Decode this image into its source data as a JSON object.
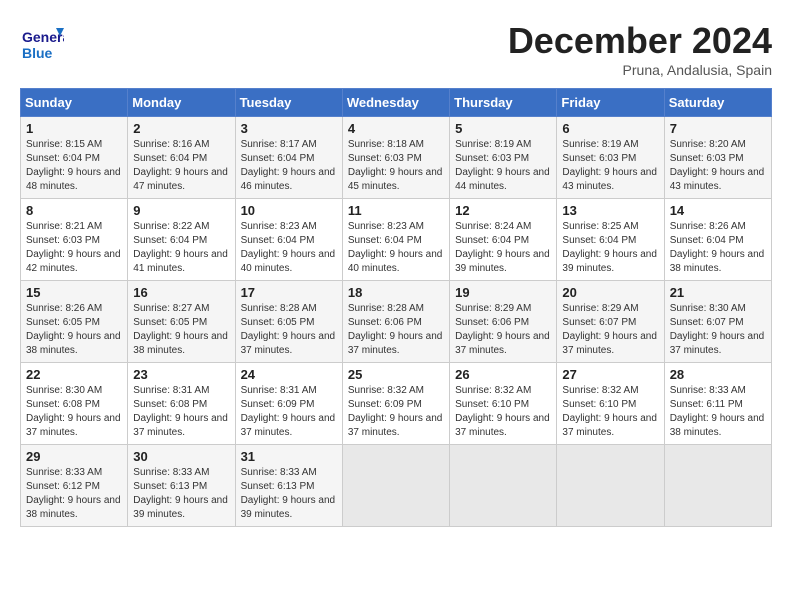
{
  "header": {
    "logo_general": "General",
    "logo_blue": "Blue",
    "month_title": "December 2024",
    "location": "Pruna, Andalusia, Spain"
  },
  "calendar": {
    "days_of_week": [
      "Sunday",
      "Monday",
      "Tuesday",
      "Wednesday",
      "Thursday",
      "Friday",
      "Saturday"
    ],
    "weeks": [
      [
        {
          "day": "",
          "empty": true
        },
        {
          "day": "",
          "empty": true
        },
        {
          "day": "",
          "empty": true
        },
        {
          "day": "",
          "empty": true
        },
        {
          "day": "",
          "empty": true
        },
        {
          "day": "",
          "empty": true
        },
        {
          "day": "1",
          "sunrise": "8:20 AM",
          "sunset": "6:03 PM",
          "daylight": "9 hours and 43 minutes."
        }
      ],
      [
        {
          "day": "2",
          "sunrise": "8:16 AM",
          "sunset": "6:04 PM",
          "daylight": "9 hours and 47 minutes."
        },
        {
          "day": "3",
          "sunrise": "8:17 AM",
          "sunset": "6:04 PM",
          "daylight": "9 hours and 46 minutes."
        },
        {
          "day": "4",
          "sunrise": "8:18 AM",
          "sunset": "6:03 PM",
          "daylight": "9 hours and 45 minutes."
        },
        {
          "day": "5",
          "sunrise": "8:19 AM",
          "sunset": "6:03 PM",
          "daylight": "9 hours and 44 minutes."
        },
        {
          "day": "6",
          "sunrise": "8:19 AM",
          "sunset": "6:03 PM",
          "daylight": "9 hours and 43 minutes."
        },
        {
          "day": "7",
          "sunrise": "8:20 AM",
          "sunset": "6:03 PM",
          "daylight": "9 hours and 43 minutes."
        },
        {
          "day": "8",
          "sunrise": "8:21 AM",
          "sunset": "6:03 PM",
          "daylight": "9 hours and 42 minutes."
        }
      ],
      [
        {
          "day": "1",
          "sunrise": "8:15 AM",
          "sunset": "6:04 PM",
          "daylight": "9 hours and 48 minutes."
        },
        {
          "day": "9",
          "sunrise": "8:22 AM",
          "sunset": "6:04 PM",
          "daylight": "9 hours and 41 minutes."
        },
        {
          "day": "10",
          "sunrise": "8:23 AM",
          "sunset": "6:04 PM",
          "daylight": "9 hours and 40 minutes."
        },
        {
          "day": "11",
          "sunrise": "8:23 AM",
          "sunset": "6:04 PM",
          "daylight": "9 hours and 40 minutes."
        },
        {
          "day": "12",
          "sunrise": "8:24 AM",
          "sunset": "6:04 PM",
          "daylight": "9 hours and 39 minutes."
        },
        {
          "day": "13",
          "sunrise": "8:25 AM",
          "sunset": "6:04 PM",
          "daylight": "9 hours and 39 minutes."
        },
        {
          "day": "14",
          "sunrise": "8:26 AM",
          "sunset": "6:04 PM",
          "daylight": "9 hours and 38 minutes."
        }
      ],
      [
        {
          "day": "15",
          "sunrise": "8:26 AM",
          "sunset": "6:05 PM",
          "daylight": "9 hours and 38 minutes."
        },
        {
          "day": "16",
          "sunrise": "8:27 AM",
          "sunset": "6:05 PM",
          "daylight": "9 hours and 38 minutes."
        },
        {
          "day": "17",
          "sunrise": "8:28 AM",
          "sunset": "6:05 PM",
          "daylight": "9 hours and 37 minutes."
        },
        {
          "day": "18",
          "sunrise": "8:28 AM",
          "sunset": "6:06 PM",
          "daylight": "9 hours and 37 minutes."
        },
        {
          "day": "19",
          "sunrise": "8:29 AM",
          "sunset": "6:06 PM",
          "daylight": "9 hours and 37 minutes."
        },
        {
          "day": "20",
          "sunrise": "8:29 AM",
          "sunset": "6:07 PM",
          "daylight": "9 hours and 37 minutes."
        },
        {
          "day": "21",
          "sunrise": "8:30 AM",
          "sunset": "6:07 PM",
          "daylight": "9 hours and 37 minutes."
        }
      ],
      [
        {
          "day": "22",
          "sunrise": "8:30 AM",
          "sunset": "6:08 PM",
          "daylight": "9 hours and 37 minutes."
        },
        {
          "day": "23",
          "sunrise": "8:31 AM",
          "sunset": "6:08 PM",
          "daylight": "9 hours and 37 minutes."
        },
        {
          "day": "24",
          "sunrise": "8:31 AM",
          "sunset": "6:09 PM",
          "daylight": "9 hours and 37 minutes."
        },
        {
          "day": "25",
          "sunrise": "8:32 AM",
          "sunset": "6:09 PM",
          "daylight": "9 hours and 37 minutes."
        },
        {
          "day": "26",
          "sunrise": "8:32 AM",
          "sunset": "6:10 PM",
          "daylight": "9 hours and 37 minutes."
        },
        {
          "day": "27",
          "sunrise": "8:32 AM",
          "sunset": "6:10 PM",
          "daylight": "9 hours and 37 minutes."
        },
        {
          "day": "28",
          "sunrise": "8:33 AM",
          "sunset": "6:11 PM",
          "daylight": "9 hours and 38 minutes."
        }
      ],
      [
        {
          "day": "29",
          "sunrise": "8:33 AM",
          "sunset": "6:12 PM",
          "daylight": "9 hours and 38 minutes."
        },
        {
          "day": "30",
          "sunrise": "8:33 AM",
          "sunset": "6:13 PM",
          "daylight": "9 hours and 39 minutes."
        },
        {
          "day": "31",
          "sunrise": "8:33 AM",
          "sunset": "6:13 PM",
          "daylight": "9 hours and 39 minutes."
        },
        {
          "day": "",
          "empty": true
        },
        {
          "day": "",
          "empty": true
        },
        {
          "day": "",
          "empty": true
        },
        {
          "day": "",
          "empty": true
        }
      ]
    ]
  }
}
